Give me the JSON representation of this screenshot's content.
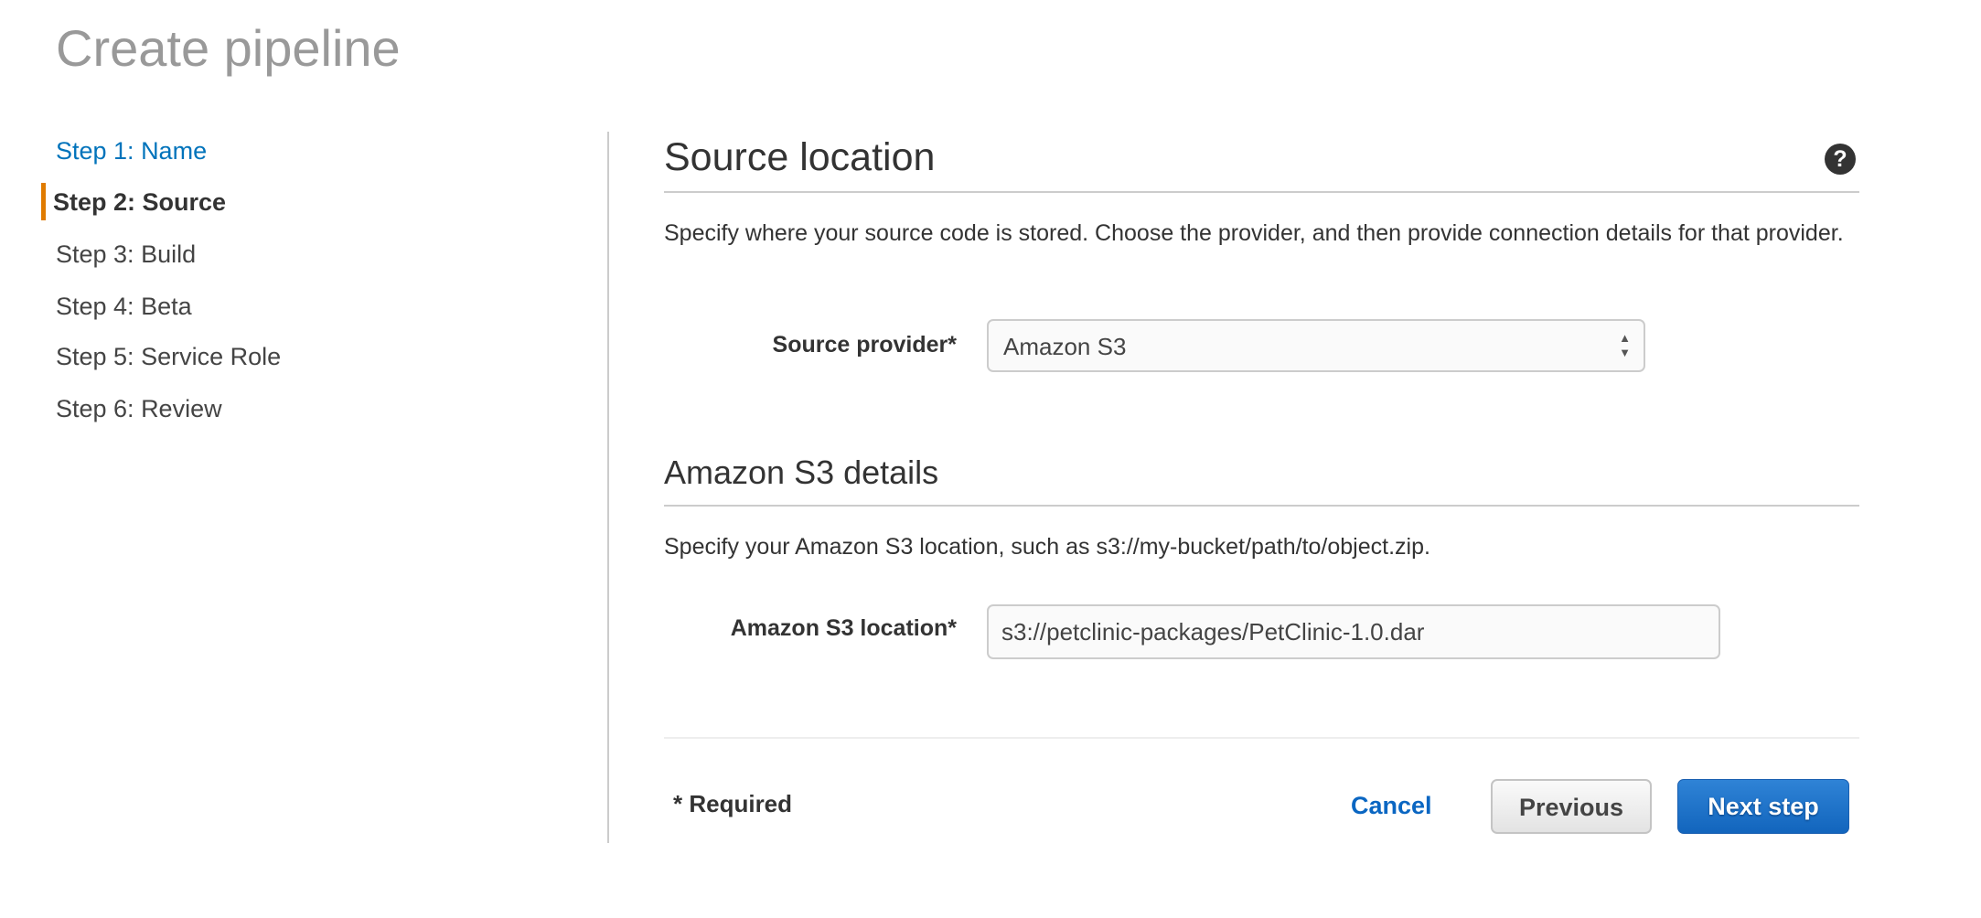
{
  "page": {
    "title": "Create pipeline"
  },
  "steps": [
    {
      "label": "Step 1: Name",
      "state": "completed"
    },
    {
      "label": "Step 2: Source",
      "state": "active"
    },
    {
      "label": "Step 3: Build",
      "state": "pending"
    },
    {
      "label": "Step 4: Beta",
      "state": "pending"
    },
    {
      "label": "Step 5: Service Role",
      "state": "pending"
    },
    {
      "label": "Step 6: Review",
      "state": "pending"
    }
  ],
  "source": {
    "heading": "Source location",
    "help_icon": "question-circle-icon",
    "help_glyph": "?",
    "description": "Specify where your source code is stored. Choose the provider, and then provide connection details for that provider.",
    "provider_label": "Source provider*",
    "provider_value": "Amazon S3"
  },
  "s3": {
    "heading": "Amazon S3 details",
    "description": "Specify your Amazon S3 location, such as s3://my-bucket/path/to/object.zip.",
    "location_label": "Amazon S3 location*",
    "location_value": "s3://petclinic-packages/PetClinic-1.0.dar"
  },
  "footer": {
    "required_note": "* Required",
    "cancel_label": "Cancel",
    "previous_label": "Previous",
    "next_label": "Next step"
  },
  "colors": {
    "accent": "#0073bb",
    "active_step": "#e07b00",
    "primary_button": "#1a6fc9"
  }
}
